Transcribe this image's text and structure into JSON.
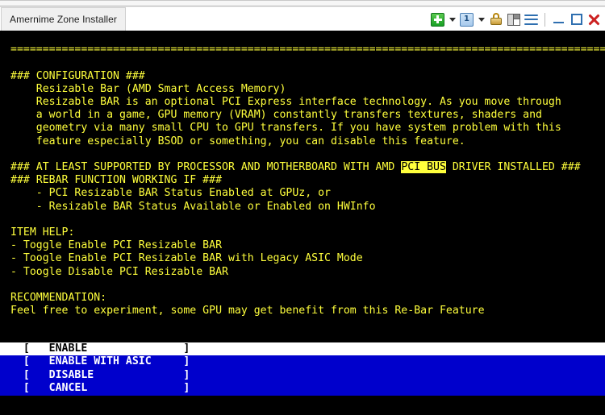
{
  "window": {
    "tab_title": "Amernime Zone Installer",
    "toolbar": {
      "new_tab_label": "+",
      "numbered_tab_label": "1",
      "icons": [
        "new-tab-icon",
        "new-tab-dropdown-icon",
        "session-tab-icon",
        "session-dropdown-icon",
        "lock-icon",
        "split-pane-icon",
        "menu-icon",
        "minimize-icon",
        "maximize-icon",
        "close-icon"
      ]
    }
  },
  "colors": {
    "terminal_bg": "#000000",
    "terminal_fg": "#ffff3c",
    "highlight_bg": "#ffff3c",
    "highlight_fg": "#000000",
    "menu_bg": "#0000cc",
    "menu_fg": "#ffffff",
    "menu_selected_bg": "#ffffff",
    "menu_selected_fg": "#000000"
  },
  "terminal": {
    "rule_top": "=================================================================================================",
    "rule_bottom": "=================================================================================================",
    "lines": [
      "### CONFIGURATION ###",
      "    Resizable Bar (AMD Smart Access Memory)",
      "    Resizable BAR is an optional PCI Express interface technology. As you move through",
      "    a world in a game, GPU memory (VRAM) constantly transfers textures, shaders and",
      "    geometry via many small CPU to GPU transfers. If you have system problem with this",
      "    feature especially BSOD or something, you can disable this feature."
    ],
    "support_line_pre": "### AT LEAST SUPPORTED BY PROCESSOR AND MOTHERBOARD WITH AMD ",
    "support_line_highlight": "PCI BUS",
    "support_line_post": " DRIVER INSTALLED ###",
    "rebar_line": "### REBAR FUNCTION WORKING IF ###",
    "rebar_conditions": [
      "    - PCI Resizable BAR Status Enabled at GPUz, or",
      "    - Resizable BAR Status Available or Enabled on HWInfo"
    ],
    "item_help_title": "ITEM HELP:",
    "item_help": [
      "- Toggle Enable PCI Resizable BAR",
      "- Toogle Enable PCI Resizable BAR with Legacy ASIC Mode",
      "- Toogle Disable PCI Resizable BAR"
    ],
    "recommendation_title": "RECOMMENDATION:",
    "recommendation_text": "Feel free to experiment, some GPU may get benefit from this Re-Bar Feature"
  },
  "menu": {
    "items": [
      {
        "label": "ENABLE",
        "row": "  [   ENABLE               ]",
        "selected": true
      },
      {
        "label": "ENABLE WITH ASIC",
        "row": "  [   ENABLE WITH ASIC     ]",
        "selected": false
      },
      {
        "label": "DISABLE",
        "row": "  [   DISABLE              ]",
        "selected": false
      },
      {
        "label": "CANCEL",
        "row": "  [   CANCEL               ]",
        "selected": false
      }
    ]
  }
}
